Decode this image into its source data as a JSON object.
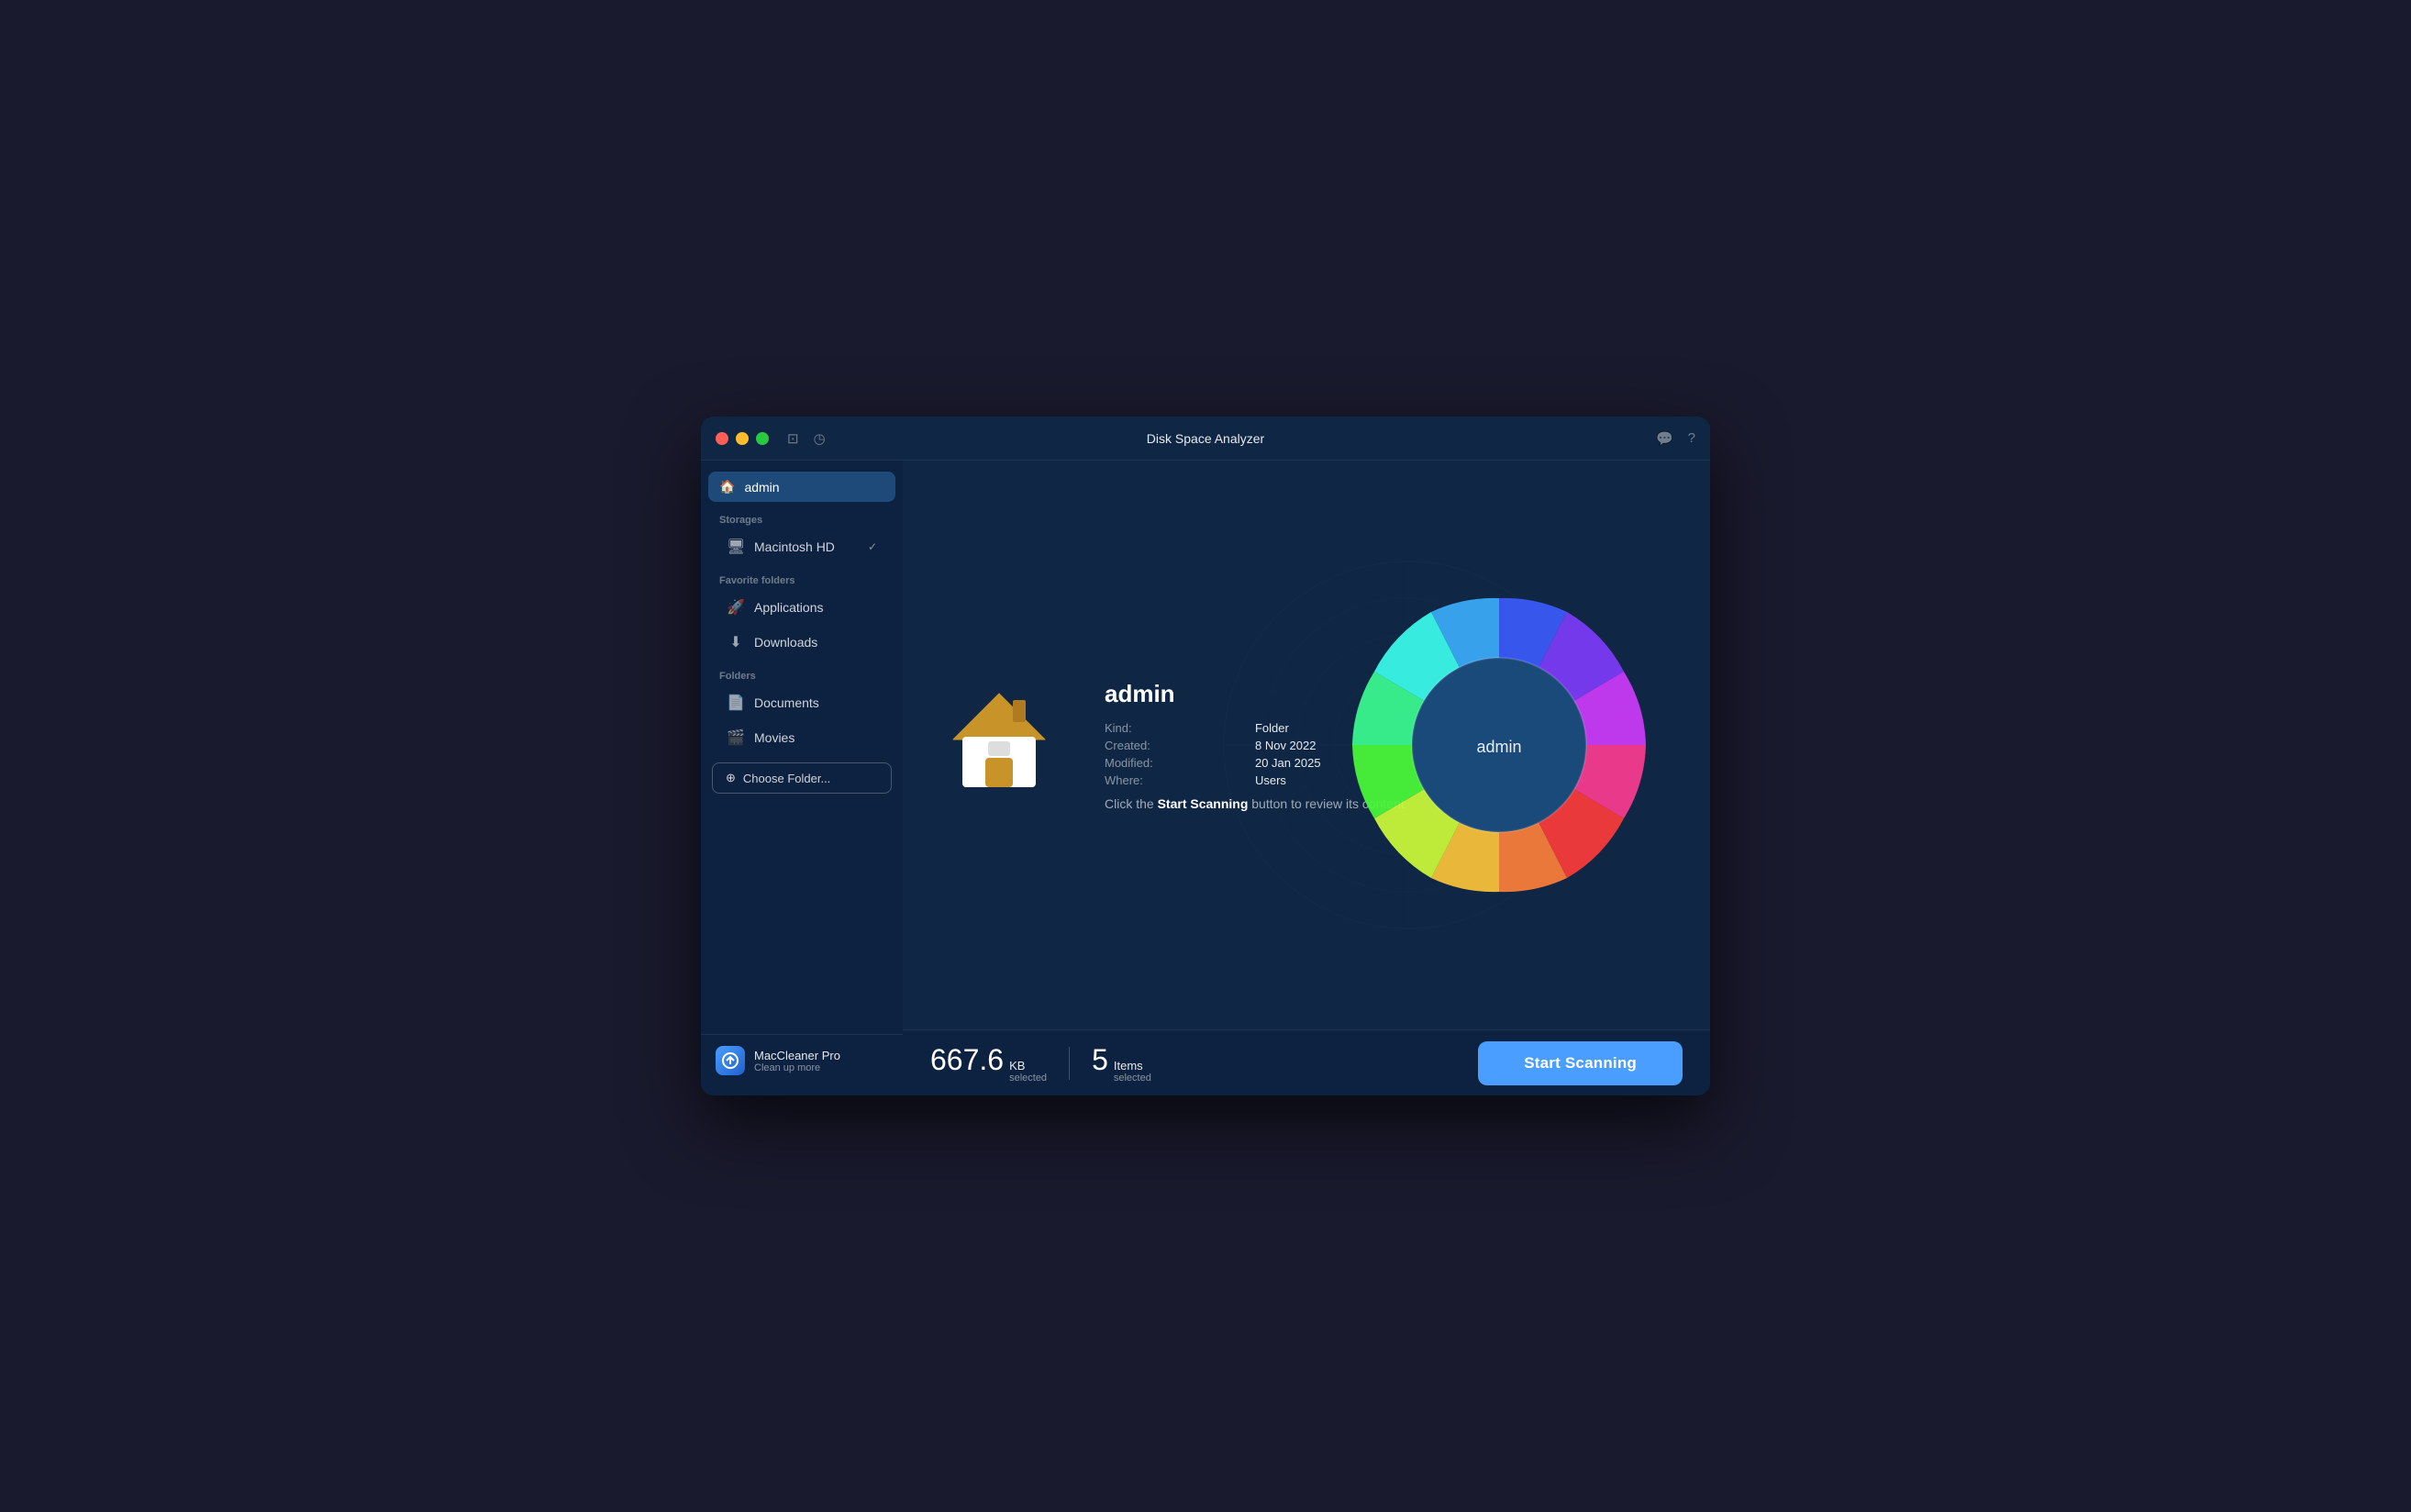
{
  "window": {
    "title": "Disk Space Analyzer"
  },
  "sidebar": {
    "active_item": "admin",
    "active_icon": "🏠",
    "storages_label": "Storages",
    "storage_name": "Macintosh HD",
    "favorite_folders_label": "Favorite folders",
    "folders_label": "Folders",
    "items": [
      {
        "id": "applications",
        "label": "Applications",
        "icon": "✈"
      },
      {
        "id": "downloads",
        "label": "Downloads",
        "icon": "⬇"
      },
      {
        "id": "documents",
        "label": "Documents",
        "icon": "📄"
      },
      {
        "id": "movies",
        "label": "Movies",
        "icon": "🎬"
      }
    ],
    "choose_folder": "Choose Folder...",
    "bottom": {
      "name": "MacCleaner Pro",
      "sub": "Clean up more"
    }
  },
  "folder": {
    "name": "admin",
    "kind_label": "Kind:",
    "kind_value": "Folder",
    "created_label": "Created:",
    "created_value": "8 Nov 2022",
    "modified_label": "Modified:",
    "modified_value": "20 Jan 2025",
    "where_label": "Where:",
    "where_value": "Users"
  },
  "hint": {
    "prefix": "Click the ",
    "bold": "Start Scanning",
    "suffix": " button to review its content"
  },
  "chart": {
    "center_label": "admin",
    "segments": [
      {
        "color": "#4a6cf7",
        "start": 0,
        "end": 25
      },
      {
        "color": "#7b4cf7",
        "start": 25,
        "end": 48
      },
      {
        "color": "#c44cf7",
        "start": 48,
        "end": 68
      },
      {
        "color": "#f74c8e",
        "start": 68,
        "end": 85
      },
      {
        "color": "#f74c4c",
        "start": 85,
        "end": 100
      },
      {
        "color": "#f78c4c",
        "start": 100,
        "end": 115
      },
      {
        "color": "#f7c44c",
        "start": 115,
        "end": 128
      },
      {
        "color": "#d4f74c",
        "start": 128,
        "end": 142
      },
      {
        "color": "#7cf74c",
        "start": 142,
        "end": 158
      },
      {
        "color": "#4cf7a0",
        "start": 158,
        "end": 175
      },
      {
        "color": "#4cf7f0",
        "start": 175,
        "end": 192
      },
      {
        "color": "#4caaf7",
        "start": 192,
        "end": 210
      }
    ]
  },
  "statusbar": {
    "size_big": "667.6",
    "size_unit": "KB",
    "size_sub": "selected",
    "items_big": "5",
    "items_unit": "Items",
    "items_sub": "selected",
    "button_label": "Start Scanning"
  }
}
